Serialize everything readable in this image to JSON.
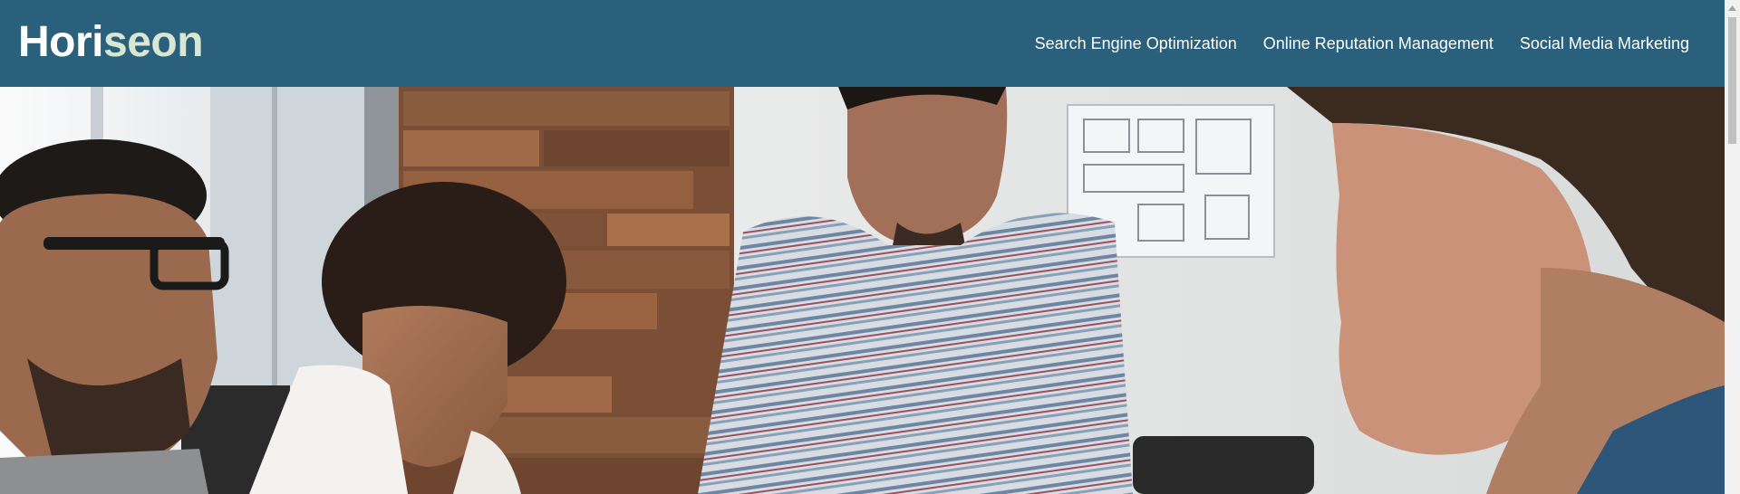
{
  "header": {
    "logo": {
      "part1": "Hori",
      "part2": "seon"
    },
    "nav": [
      {
        "label": "Search Engine Optimization"
      },
      {
        "label": "Online Reputation Management"
      },
      {
        "label": "Social Media Marketing"
      }
    ]
  },
  "hero": {
    "image": "team-meeting-photo"
  },
  "colors": {
    "header_bg": "#2a607c",
    "logo_primary": "#ffffff",
    "logo_accent": "#d9e6d4",
    "nav_text": "#ffffff"
  }
}
